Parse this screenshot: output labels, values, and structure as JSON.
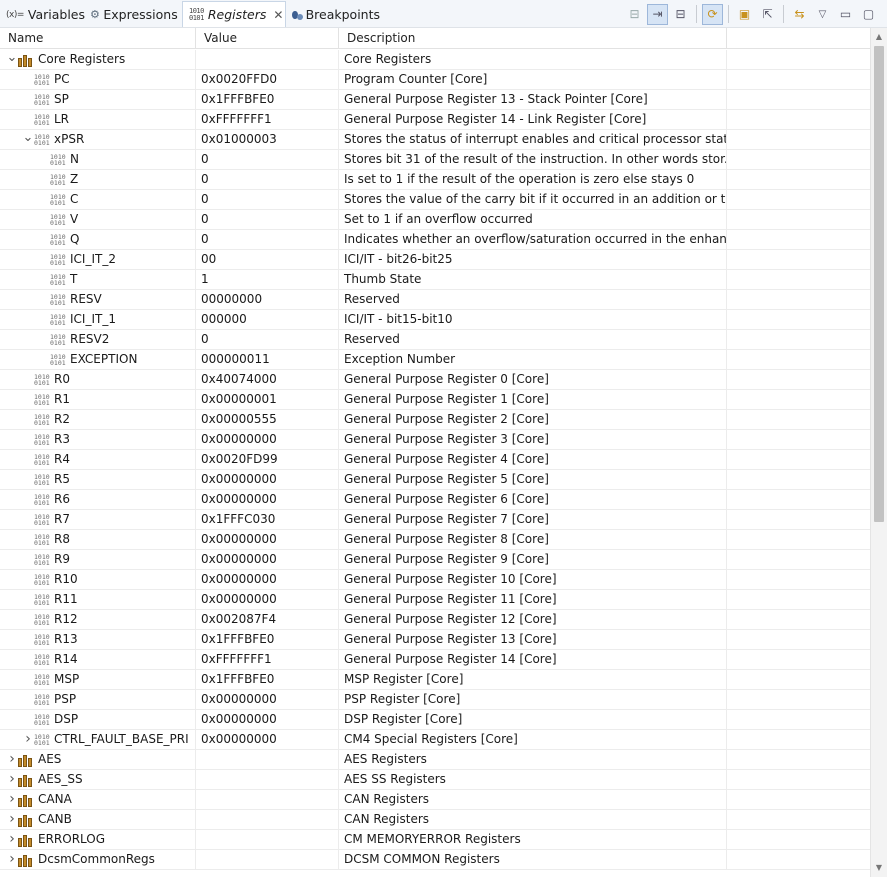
{
  "tabs": [
    {
      "icon": "(x)=",
      "label": "Variables",
      "active": false
    },
    {
      "icon": "expr",
      "label": "Expressions",
      "active": false
    },
    {
      "icon": "1010",
      "label": "Registers",
      "active": true
    },
    {
      "icon": "bp",
      "label": "Breakpoints",
      "active": false
    }
  ],
  "toolbar_icons": [
    "show-type-icon",
    "collapse-source-icon",
    "minimize-icon",
    "refresh-icon",
    "new-group-icon",
    "export-icon",
    "sync-icon",
    "view-menu-icon",
    "minimize-view-icon",
    "maximize-view-icon"
  ],
  "columns": {
    "name": "Name",
    "value": "Value",
    "description": "Description"
  },
  "rows": [
    {
      "level": 0,
      "twisty": "open",
      "icon": "group",
      "name": "Core Registers",
      "value": "",
      "desc": "Core Registers"
    },
    {
      "level": 1,
      "twisty": "",
      "icon": "reg",
      "name": "PC",
      "value": "0x0020FFD0",
      "desc": "Program Counter [Core]"
    },
    {
      "level": 1,
      "twisty": "",
      "icon": "reg",
      "name": "SP",
      "value": "0x1FFFBFE0",
      "desc": "General Purpose Register 13 - Stack Pointer [Core]"
    },
    {
      "level": 1,
      "twisty": "",
      "icon": "reg",
      "name": "LR",
      "value": "0xFFFFFFF1",
      "desc": "General Purpose Register 14 - Link Register [Core]"
    },
    {
      "level": 1,
      "twisty": "open",
      "icon": "reg",
      "name": "xPSR",
      "value": "0x01000003",
      "desc": "Stores the status of interrupt enables and critical processor stat..."
    },
    {
      "level": 2,
      "twisty": "",
      "icon": "reg",
      "name": "N",
      "value": "0",
      "desc": "Stores bit 31 of the result of the instruction. In other words stor..."
    },
    {
      "level": 2,
      "twisty": "",
      "icon": "reg",
      "name": "Z",
      "value": "0",
      "desc": "Is set to 1 if the result of the operation is zero else stays 0"
    },
    {
      "level": 2,
      "twisty": "",
      "icon": "reg",
      "name": "C",
      "value": "0",
      "desc": "Stores the value of the carry bit if it occurred in an addition or t..."
    },
    {
      "level": 2,
      "twisty": "",
      "icon": "reg",
      "name": "V",
      "value": "0",
      "desc": "Set to 1 if an overflow occurred"
    },
    {
      "level": 2,
      "twisty": "",
      "icon": "reg",
      "name": "Q",
      "value": "0",
      "desc": "Indicates whether an overflow/saturation occurred in the enhan..."
    },
    {
      "level": 2,
      "twisty": "",
      "icon": "reg",
      "name": "ICI_IT_2",
      "value": "00",
      "desc": "ICI/IT - bit26-bit25"
    },
    {
      "level": 2,
      "twisty": "",
      "icon": "reg",
      "name": "T",
      "value": "1",
      "desc": "Thumb State"
    },
    {
      "level": 2,
      "twisty": "",
      "icon": "reg",
      "name": "RESV",
      "value": "00000000",
      "desc": "Reserved"
    },
    {
      "level": 2,
      "twisty": "",
      "icon": "reg",
      "name": "ICI_IT_1",
      "value": "000000",
      "desc": "ICI/IT - bit15-bit10"
    },
    {
      "level": 2,
      "twisty": "",
      "icon": "reg",
      "name": "RESV2",
      "value": "0",
      "desc": "Reserved"
    },
    {
      "level": 2,
      "twisty": "",
      "icon": "reg",
      "name": "EXCEPTION",
      "value": "000000011",
      "desc": "Exception Number"
    },
    {
      "level": 1,
      "twisty": "",
      "icon": "reg",
      "name": "R0",
      "value": "0x40074000",
      "desc": "General Purpose Register 0 [Core]"
    },
    {
      "level": 1,
      "twisty": "",
      "icon": "reg",
      "name": "R1",
      "value": "0x00000001",
      "desc": "General Purpose Register 1 [Core]"
    },
    {
      "level": 1,
      "twisty": "",
      "icon": "reg",
      "name": "R2",
      "value": "0x00000555",
      "desc": "General Purpose Register 2 [Core]"
    },
    {
      "level": 1,
      "twisty": "",
      "icon": "reg",
      "name": "R3",
      "value": "0x00000000",
      "desc": "General Purpose Register 3 [Core]"
    },
    {
      "level": 1,
      "twisty": "",
      "icon": "reg",
      "name": "R4",
      "value": "0x0020FD99",
      "desc": "General Purpose Register 4 [Core]"
    },
    {
      "level": 1,
      "twisty": "",
      "icon": "reg",
      "name": "R5",
      "value": "0x00000000",
      "desc": "General Purpose Register 5 [Core]"
    },
    {
      "level": 1,
      "twisty": "",
      "icon": "reg",
      "name": "R6",
      "value": "0x00000000",
      "desc": "General Purpose Register 6 [Core]"
    },
    {
      "level": 1,
      "twisty": "",
      "icon": "reg",
      "name": "R7",
      "value": "0x1FFFC030",
      "desc": "General Purpose Register 7 [Core]"
    },
    {
      "level": 1,
      "twisty": "",
      "icon": "reg",
      "name": "R8",
      "value": "0x00000000",
      "desc": "General Purpose Register 8 [Core]"
    },
    {
      "level": 1,
      "twisty": "",
      "icon": "reg",
      "name": "R9",
      "value": "0x00000000",
      "desc": "General Purpose Register 9 [Core]"
    },
    {
      "level": 1,
      "twisty": "",
      "icon": "reg",
      "name": "R10",
      "value": "0x00000000",
      "desc": "General Purpose Register 10 [Core]"
    },
    {
      "level": 1,
      "twisty": "",
      "icon": "reg",
      "name": "R11",
      "value": "0x00000000",
      "desc": "General Purpose Register 11 [Core]"
    },
    {
      "level": 1,
      "twisty": "",
      "icon": "reg",
      "name": "R12",
      "value": "0x002087F4",
      "desc": "General Purpose Register 12 [Core]"
    },
    {
      "level": 1,
      "twisty": "",
      "icon": "reg",
      "name": "R13",
      "value": "0x1FFFBFE0",
      "desc": "General Purpose Register 13 [Core]"
    },
    {
      "level": 1,
      "twisty": "",
      "icon": "reg",
      "name": "R14",
      "value": "0xFFFFFFF1",
      "desc": "General Purpose Register 14 [Core]"
    },
    {
      "level": 1,
      "twisty": "",
      "icon": "reg",
      "name": "MSP",
      "value": "0x1FFFBFE0",
      "desc": "MSP Register [Core]"
    },
    {
      "level": 1,
      "twisty": "",
      "icon": "reg",
      "name": "PSP",
      "value": "0x00000000",
      "desc": "PSP Register [Core]"
    },
    {
      "level": 1,
      "twisty": "",
      "icon": "reg",
      "name": "DSP",
      "value": "0x00000000",
      "desc": "DSP Register [Core]"
    },
    {
      "level": 1,
      "twisty": "closed",
      "icon": "reg",
      "name": "CTRL_FAULT_BASE_PRI",
      "value": "0x00000000",
      "desc": "CM4 Special Registers [Core]"
    },
    {
      "level": 0,
      "twisty": "closed",
      "icon": "group",
      "name": "AES",
      "value": "",
      "desc": "AES Registers"
    },
    {
      "level": 0,
      "twisty": "closed",
      "icon": "group",
      "name": "AES_SS",
      "value": "",
      "desc": "AES SS Registers"
    },
    {
      "level": 0,
      "twisty": "closed",
      "icon": "group",
      "name": "CANA",
      "value": "",
      "desc": "CAN Registers"
    },
    {
      "level": 0,
      "twisty": "closed",
      "icon": "group",
      "name": "CANB",
      "value": "",
      "desc": "CAN Registers"
    },
    {
      "level": 0,
      "twisty": "closed",
      "icon": "group",
      "name": "ERRORLOG",
      "value": "",
      "desc": "CM MEMORYERROR Registers"
    },
    {
      "level": 0,
      "twisty": "closed",
      "icon": "group",
      "name": "DcsmCommonRegs",
      "value": "",
      "desc": "DCSM COMMON Registers"
    }
  ]
}
